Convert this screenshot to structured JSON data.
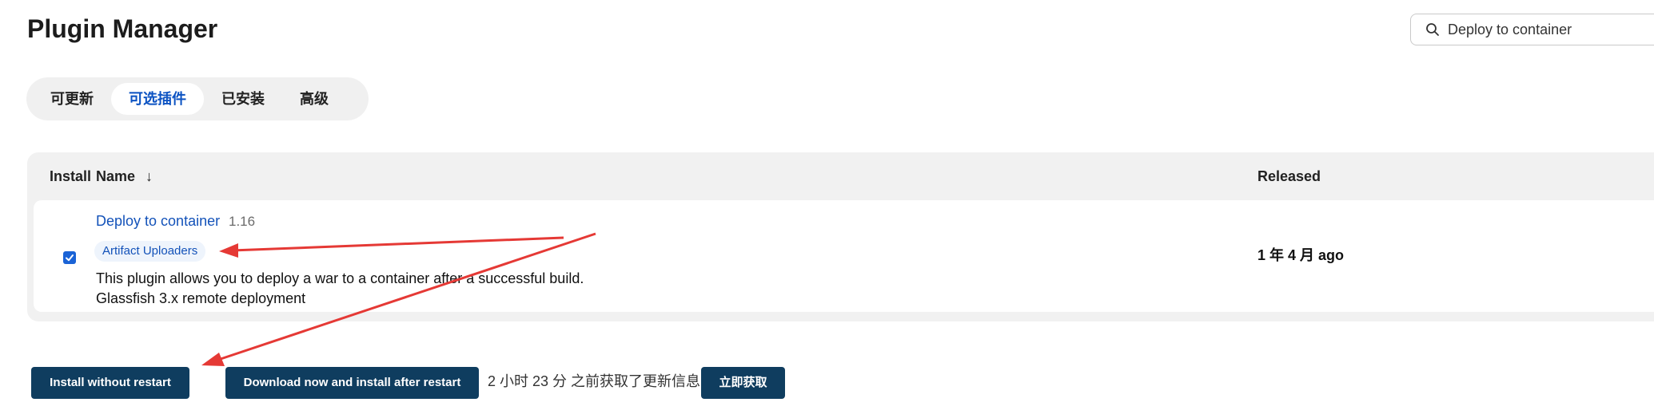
{
  "page": {
    "title": "Plugin Manager"
  },
  "search": {
    "value": "Deploy to container"
  },
  "tabs": [
    {
      "label": "可更新",
      "active": false
    },
    {
      "label": "可选插件",
      "active": true
    },
    {
      "label": "已安装",
      "active": false
    },
    {
      "label": "高级",
      "active": false
    }
  ],
  "table": {
    "headers": {
      "install": "Install",
      "name": "Name",
      "sort_indicator": "↓",
      "released": "Released"
    },
    "rows": [
      {
        "checked": true,
        "name": "Deploy to container",
        "version": "1.16",
        "category": "Artifact Uploaders",
        "description_line1": "This plugin allows you to deploy a war to a container after a successful build.",
        "description_line2": "Glassfish 3.x remote deployment",
        "released": "1 年 4 月 ago"
      }
    ]
  },
  "footer": {
    "install_without_restart": "Install without restart",
    "download_install_after_restart": "Download now and install after restart",
    "update_info": "2 小时 23 分 之前获取了更新信息",
    "check_now": "立即获取"
  },
  "colors": {
    "accent": "#0b52c2",
    "button": "#0f3d5f",
    "annotation_arrow": "#e53935"
  }
}
